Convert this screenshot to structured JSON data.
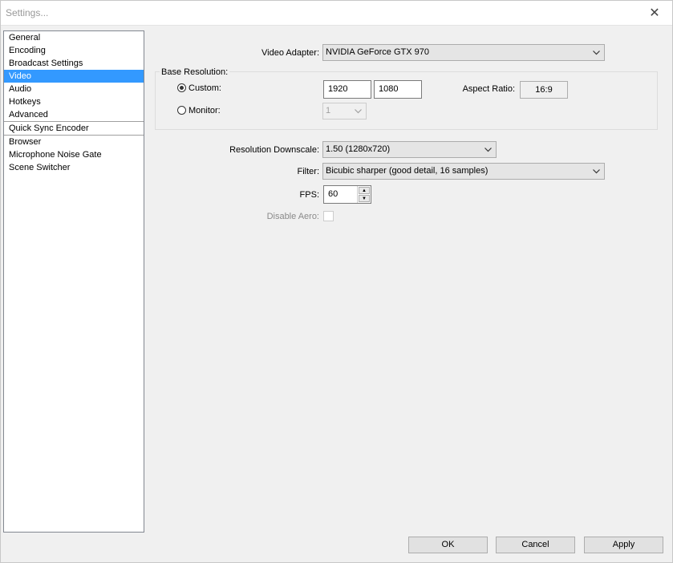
{
  "window": {
    "title": "Settings...",
    "close_glyph": "✕"
  },
  "sidebar": {
    "items": [
      {
        "label": "General"
      },
      {
        "label": "Encoding"
      },
      {
        "label": "Broadcast Settings"
      },
      {
        "label": "Video",
        "selected": true
      },
      {
        "label": "Audio"
      },
      {
        "label": "Hotkeys"
      },
      {
        "label": "Advanced"
      },
      {
        "label": "Quick Sync Encoder"
      },
      {
        "label": "Browser"
      },
      {
        "label": "Microphone Noise Gate"
      },
      {
        "label": "Scene Switcher"
      }
    ]
  },
  "video": {
    "adapter_label": "Video Adapter:",
    "adapter_value": "NVIDIA GeForce GTX 970",
    "base_resolution_title": "Base Resolution:",
    "custom_label": "Custom:",
    "custom_width": "1920",
    "custom_height": "1080",
    "aspect_label": "Aspect Ratio:",
    "aspect_value": "16:9",
    "monitor_label": "Monitor:",
    "monitor_value": "1",
    "downscale_label": "Resolution Downscale:",
    "downscale_value": "1.50  (1280x720)",
    "filter_label": "Filter:",
    "filter_value": "Bicubic sharper (good detail, 16 samples)",
    "fps_label": "FPS:",
    "fps_value": "60",
    "disable_aero_label": "Disable Aero:"
  },
  "buttons": {
    "ok": "OK",
    "cancel": "Cancel",
    "apply": "Apply"
  }
}
